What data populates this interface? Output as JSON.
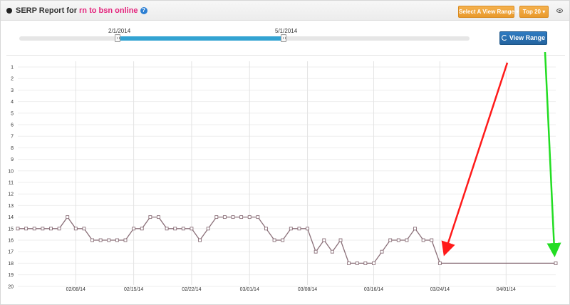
{
  "header": {
    "title_prefix": "SERP Report for ",
    "keyword": "rn to bsn online",
    "help_label": "?",
    "select_range_label": "Select A View Range ▾",
    "top_label": "Top 20 ▾"
  },
  "slider": {
    "start_label": "2/1/2014",
    "end_label": "5/1/2014"
  },
  "view_range_label": "View Range",
  "colors": {
    "slider_fill": "#33a3d2",
    "line": "#8a6f78",
    "arrow_red": "#ff1a1a",
    "arrow_green": "#22dd22"
  },
  "chart_data": {
    "type": "line",
    "y_reversed": true,
    "ylim": [
      1,
      20
    ],
    "y_ticks": [
      "1",
      "2",
      "3",
      "4",
      "5",
      "6",
      "7",
      "8",
      "9",
      "10",
      "11",
      "12",
      "13",
      "14",
      "15",
      "16",
      "17",
      "18",
      "19",
      "20"
    ],
    "x_ticks": [
      "02/08/14",
      "02/15/14",
      "02/22/14",
      "03/01/14",
      "03/08/14",
      "03/16/14",
      "03/24/14",
      "04/01/14"
    ],
    "x_tick_days": [
      7,
      14,
      21,
      28,
      35,
      43,
      51,
      59
    ],
    "series": [
      {
        "name": "",
        "x": [
          0,
          1,
          2,
          3,
          4,
          5,
          6,
          7,
          8,
          9,
          10,
          11,
          12,
          13,
          14,
          15,
          16,
          17,
          18,
          19,
          20,
          21,
          22,
          23,
          24,
          25,
          26,
          27,
          28,
          29,
          30,
          31,
          32,
          33,
          34,
          35,
          36,
          37,
          38,
          39,
          40,
          41,
          42,
          43,
          44,
          45,
          46,
          47,
          48,
          49,
          50,
          51,
          65
        ],
        "values": [
          15,
          15,
          15,
          15,
          15,
          15,
          14,
          15,
          15,
          16,
          16,
          16,
          16,
          16,
          15,
          15,
          14,
          14,
          15,
          15,
          15,
          15,
          16,
          15,
          14,
          14,
          14,
          14,
          14,
          14,
          15,
          16,
          16,
          15,
          15,
          15,
          17,
          16,
          17,
          16,
          18,
          18,
          18,
          18,
          17,
          16,
          16,
          16,
          15,
          16,
          16,
          18,
          18
        ]
      }
    ]
  }
}
